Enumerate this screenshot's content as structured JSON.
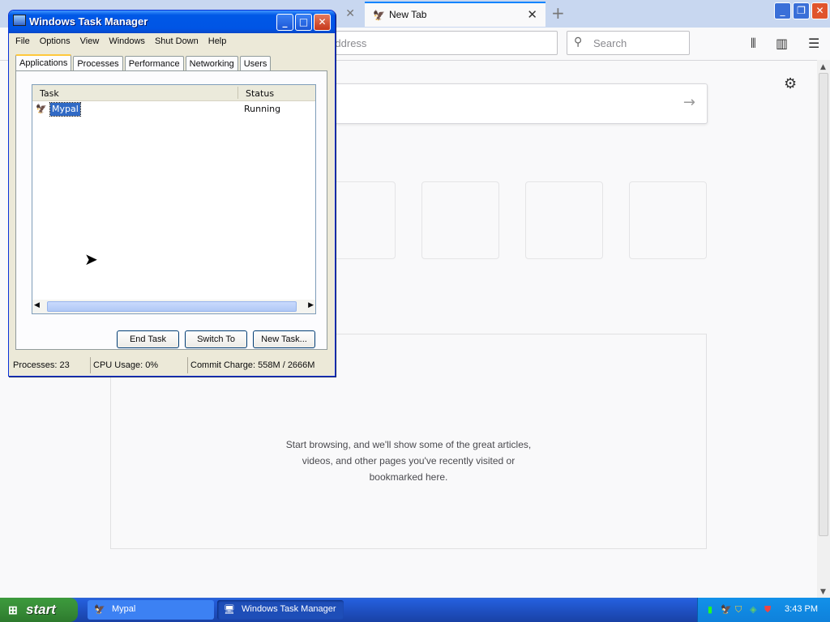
{
  "browser": {
    "tabs": [
      {
        "title": ""
      },
      {
        "title": "New Tab"
      }
    ],
    "urlbar_placeholder": "er address",
    "search_placeholder": "Search",
    "highlights_text": "Start browsing, and we'll show some of the great articles, videos, and other pages you've recently visited or bookmarked here.",
    "highlights_lines": [
      "Start browsing, and we'll show some of the great articles,",
      "videos, and other pages you've recently visited or",
      "bookmarked here."
    ]
  },
  "task_manager": {
    "title": "Windows Task Manager",
    "menu": [
      "File",
      "Options",
      "View",
      "Windows",
      "Shut Down",
      "Help"
    ],
    "tabs": [
      "Applications",
      "Processes",
      "Performance",
      "Networking",
      "Users"
    ],
    "active_tab": "Applications",
    "columns": {
      "task": "Task",
      "status": "Status"
    },
    "rows": [
      {
        "task": "Mypal",
        "status": "Running"
      }
    ],
    "buttons": {
      "end_task": "End Task",
      "switch_to": "Switch To",
      "new_task": "New Task..."
    },
    "status_bar": {
      "processes": "Processes: 23",
      "cpu": "CPU Usage: 0%",
      "commit": "Commit Charge: 558M / 2666M"
    }
  },
  "taskbar": {
    "start_label": "start",
    "buttons": [
      {
        "label": "Mypal"
      },
      {
        "label": "Windows Task Manager"
      }
    ],
    "clock": "3:43 PM"
  }
}
